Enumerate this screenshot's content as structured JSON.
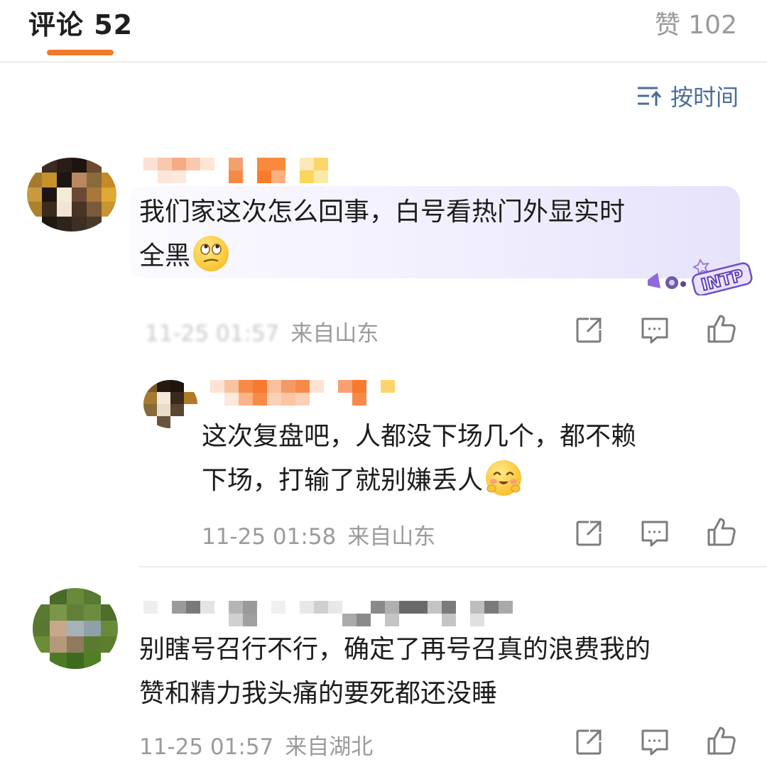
{
  "header": {
    "comments_label": "评论 52",
    "likes_label": "赞 102",
    "sort_label": "按时间",
    "accent_color": "#f07a2a"
  },
  "comments": [
    {
      "text_lines": [
        "我们家这次怎么回事，白号看热门外显实时",
        "全黑"
      ],
      "emoji": "rolling-eyes-emoji",
      "time": "11-25 01:57",
      "location": "来自山东",
      "badge": "INTP",
      "reply": {
        "text_lines": [
          "这次复盘吧，人都没下场几个，都不赖",
          "下场，打输了就别嫌丢人"
        ],
        "emoji": "blushing-smile-emoji",
        "time": "11-25 01:58",
        "location": "来自山东"
      }
    },
    {
      "text_lines": [
        "别瞎号召行不行，确定了再号召真的浪费我的",
        "赞和精力我头痛的要死都还没睡"
      ],
      "time": "11-25 01:57",
      "location": "来自湖北"
    }
  ]
}
